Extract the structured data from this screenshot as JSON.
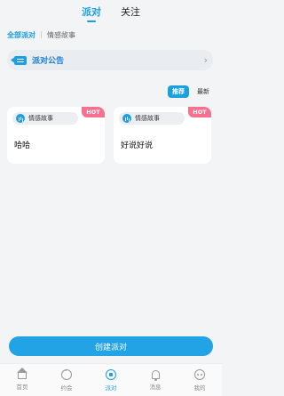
{
  "top_tabs": [
    {
      "label": "派对",
      "active": true
    },
    {
      "label": "关注",
      "active": false
    }
  ],
  "sub_tabs": [
    {
      "label": "全部派对",
      "active": true
    },
    {
      "label": "情感故事",
      "active": false
    }
  ],
  "announcement": {
    "label": "派对公告",
    "icon": "megaphone-icon"
  },
  "sort": [
    {
      "label": "推荐",
      "active": true
    },
    {
      "label": "最新",
      "active": false
    }
  ],
  "cards": [
    {
      "tag": "情感故事",
      "badge": "HOT",
      "title": "哈哈"
    },
    {
      "tag": "情感故事",
      "badge": "HOT",
      "title": "好说好说"
    }
  ],
  "create_button": "创建派对",
  "bottom_nav": [
    {
      "label": "首页",
      "icon": "home-icon",
      "active": false
    },
    {
      "label": "约会",
      "icon": "chat-icon",
      "active": false
    },
    {
      "label": "派对",
      "icon": "party-icon",
      "active": true
    },
    {
      "label": "消息",
      "icon": "bell-icon",
      "active": false
    },
    {
      "label": "我的",
      "icon": "profile-icon",
      "active": false
    }
  ],
  "colors": {
    "accent": "#1a9fe0",
    "hot_badge": "#f5718f",
    "create_button": "#22a3e6"
  }
}
